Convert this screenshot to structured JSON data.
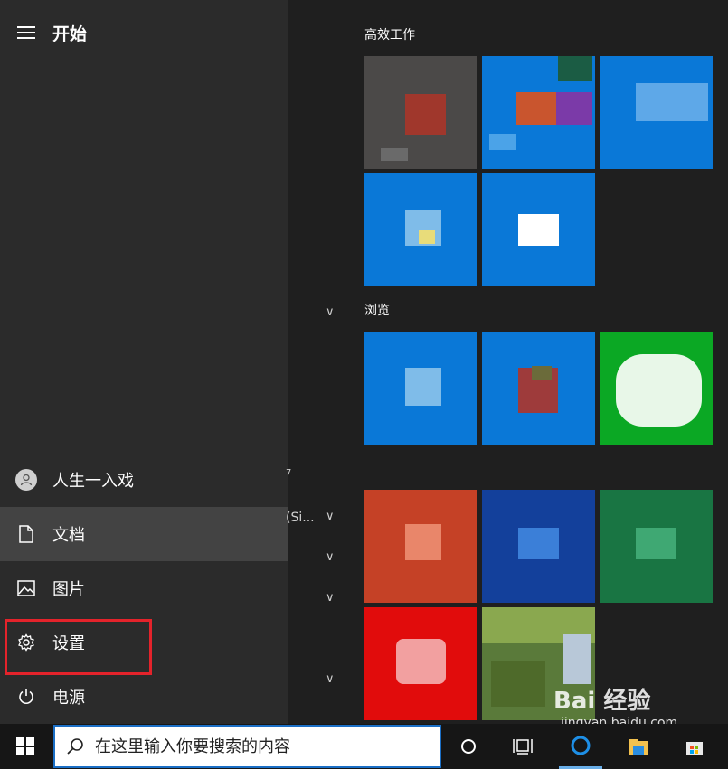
{
  "start": {
    "title": "开始",
    "menu_icon": "hamburger-icon"
  },
  "user": {
    "name": "人生一入戏",
    "icon": "user-avatar-icon"
  },
  "nav_items": [
    {
      "label": "文档",
      "icon": "document-icon"
    },
    {
      "label": "图片",
      "icon": "image-icon"
    },
    {
      "label": "设置",
      "icon": "gear-icon"
    },
    {
      "label": "电源",
      "icon": "power-icon"
    }
  ],
  "applist": {
    "fragment_1": "7",
    "fragment_2": "(Si..."
  },
  "groups": {
    "group_1": "高效工作",
    "group_2": "浏览"
  },
  "tile_colors": {
    "gray": "#4b4948",
    "blue": "#0a78d7",
    "dark_blue": "#13409b",
    "green": "#0ba824",
    "orange": "#c54126",
    "dark_green": "#197543",
    "red": "#e10c0c"
  },
  "taskbar": {
    "search_placeholder": "在这里输入你要搜索的内容",
    "search_icon": "search-icon",
    "windows_icon": "windows-logo-icon",
    "cortana_icon": "circle-icon",
    "task_view_icon": "task-view-icon"
  },
  "watermark": {
    "text": "Bai 经验",
    "sub": "jingyan.baidu.com"
  },
  "highlight_color": "#e4232b"
}
